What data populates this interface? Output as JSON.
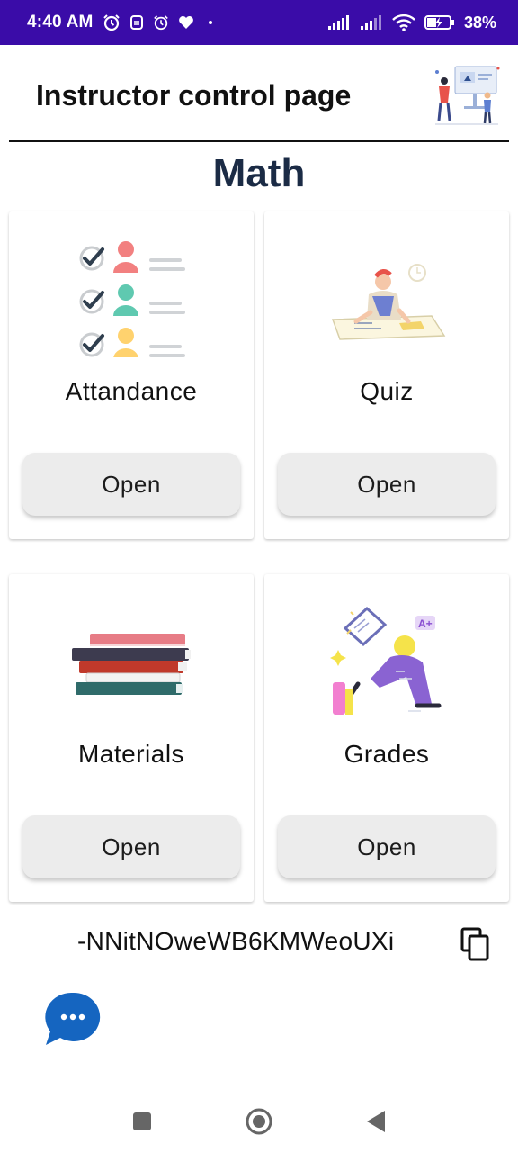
{
  "status_bar": {
    "time": "4:40 AM",
    "battery": "38%",
    "icons": [
      "alarm-icon",
      "shield-icon",
      "alarm-icon",
      "heart-icon",
      "dot-icon",
      "signal-icon",
      "signal-icon",
      "wifi-icon",
      "battery-charging-icon"
    ],
    "background": "#3a0ca8"
  },
  "header": {
    "title": "Instructor control page",
    "illustration": "teacher-presentation-illustration"
  },
  "subject": {
    "name": "Math",
    "color": "#1b2b45"
  },
  "cards": [
    {
      "title": "Attandance",
      "button": "Open",
      "illustration": "attendance-checklist-illustration"
    },
    {
      "title": "Quiz",
      "button": "Open",
      "illustration": "student-writing-illustration"
    },
    {
      "title": "Materials",
      "button": "Open",
      "illustration": "book-stack-illustration"
    },
    {
      "title": "Grades",
      "button": "Open",
      "illustration": "student-reading-grades-illustration"
    }
  ],
  "class_code": {
    "value": "-NNitNOweWB6KMWeoUXi",
    "copy_icon": "copy-icon"
  },
  "chat": {
    "icon": "chat-bubble-icon",
    "color": "#1565c0"
  },
  "nav_bar": {
    "icons": [
      "recents-square-icon",
      "home-circle-icon",
      "back-triangle-icon"
    ]
  }
}
